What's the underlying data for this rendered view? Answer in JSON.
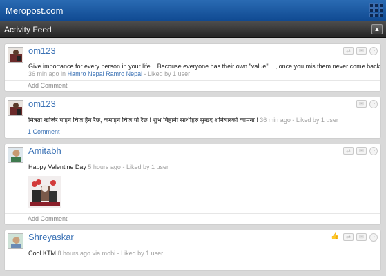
{
  "header": {
    "brand": "Meropost.com"
  },
  "subheader": {
    "title": "Activity Feed",
    "collapse_glyph": "▲"
  },
  "posts": [
    {
      "user": "om123",
      "text": "Give importance for every person in your life... Becouse everyone has their own \"value\" .. , once you mis them never come back",
      "time": "36 min ago in",
      "group": "Hamro Nepal Ramro Nepal",
      "likes": "- Liked by 1 user",
      "footer": "Add Comment"
    },
    {
      "user": "om123",
      "text": "मित्रता खोजेर पाइने चिज हैन रैछ, कमाइने चिज पो रैछ ! शुभ बिहानी साथीहरु सुखद शनिबारको कामना !",
      "meta": "36 min ago - Liked by 1 user",
      "footer": "1 Comment"
    },
    {
      "user": "Amitabh",
      "text": "Happy Valentine Day",
      "meta": "5 hours ago - Liked by 1 user",
      "footer": "Add Comment"
    },
    {
      "user": "Shreyaskar",
      "text": "Cool KTM",
      "meta": "8 hours ago via mobi - Liked by 1 user"
    }
  ],
  "icons": [
    "repost-icon",
    "mail-icon",
    "comment-icon",
    "like-icon"
  ],
  "colors": {
    "header_blue": "#1a5aa6",
    "link_blue": "#3b72b5",
    "subbar_dark": "#2f2f2f"
  }
}
